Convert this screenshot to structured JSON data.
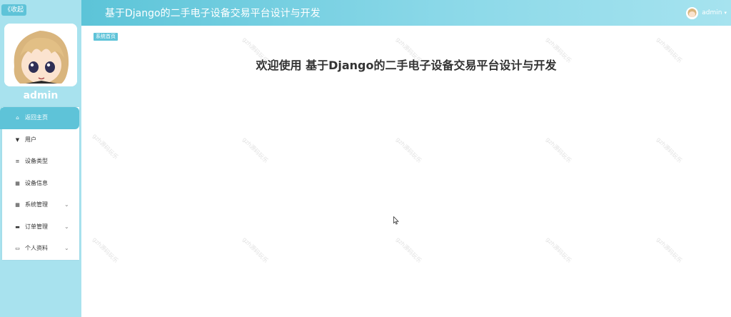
{
  "sidebar": {
    "collapse_label": "《收起",
    "user_name": "admin",
    "menu": [
      {
        "label": "返回主页",
        "icon": "⌂",
        "active": true,
        "has_sub": false
      },
      {
        "label": "用户",
        "icon": "▼",
        "active": false,
        "has_sub": false
      },
      {
        "label": "设备类型",
        "icon": "≡",
        "active": false,
        "has_sub": false
      },
      {
        "label": "设备信息",
        "icon": "▦",
        "active": false,
        "has_sub": false
      },
      {
        "label": "系统管理",
        "icon": "▦",
        "active": false,
        "has_sub": true
      },
      {
        "label": "订单管理",
        "icon": "▬",
        "active": false,
        "has_sub": true
      },
      {
        "label": "个人资料",
        "icon": "▭",
        "active": false,
        "has_sub": true
      }
    ],
    "chevron": "⌄"
  },
  "header": {
    "title": "基于Django的二手电子设备交易平台设计与开发",
    "user_name": "admin",
    "caret": "▾"
  },
  "main": {
    "breadcrumb": "系统首页",
    "welcome": "欢迎使用 基于Django的二手电子设备交易平台设计与开发",
    "watermark": "gzh源码玩乐"
  },
  "colors": {
    "accent": "#5ec3d8",
    "sidebar_bg": "#a8e2ee"
  }
}
